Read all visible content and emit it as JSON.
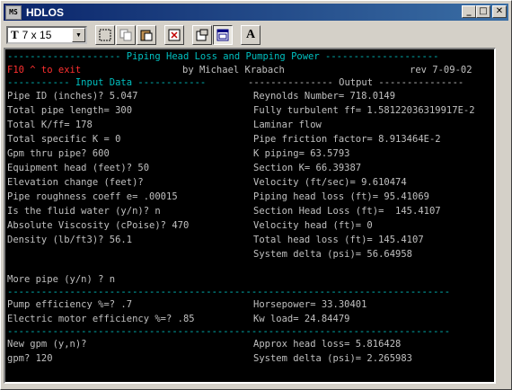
{
  "window": {
    "title": "HDLOS",
    "icon_label": "MS",
    "minimize": "_",
    "maximize": "□",
    "close": "✕"
  },
  "toolbar": {
    "font_size": "7 x 15",
    "font_icon": "T",
    "text_button": "A"
  },
  "terminal": {
    "title_line": "-------------------- Piping Head Loss and Pumping Power --------------------",
    "header_exit": "F10 ^ to exit",
    "header_author": "by Michael Krabach",
    "header_rev": "rev 7-09-02",
    "input_header": "----------- Input Data ------------",
    "output_header": "--------------- Output ---------------",
    "inputs": [
      "Pipe ID (inches)? 5.047",
      "Total pipe length= 300",
      "Total K/ff= 178",
      "Total specific K = 0",
      "Gpm thru pipe? 600",
      "Equipment head (feet)? 50",
      "Elevation change (feet)?",
      "Pipe roughness coeff e= .00015",
      "Is the fluid water (y/n)? n",
      "Absolute Viscosity (cPoise)? 470",
      "Density (lb/ft3)? 56.1"
    ],
    "outputs": [
      "Reynolds Number= 718.0149",
      "Fully turbulent ff= 1.58122036319917E-2",
      "Laminar flow",
      "Pipe friction factor= 8.913464E-2",
      "K piping= 63.5793",
      "Section K= 66.39387",
      "Velocity (ft/sec)= 9.610474",
      "Piping head loss (ft)= 95.41069",
      "Section Head Loss (ft)=  145.4107",
      "Velocity head (ft)= 0",
      "Total head loss (ft)= 145.4107",
      "System delta (psi)= 56.64958"
    ],
    "more_pipe": "More pipe (y/n) ? n",
    "separator": "------------------------------------------------------------------------------",
    "pump_eff": "Pump efficiency %=? .7",
    "horsepower": "Horsepower= 33.30401",
    "motor_eff": "Electric motor efficiency %=? .85",
    "kw_load": "Kw load= 24.84479",
    "new_gpm": "New gpm (y,n)?",
    "approx_head": "Approx head loss= 5.816428",
    "gpm": "gpm? 120",
    "system_delta2": "System delta (psi)= 2.265983"
  }
}
